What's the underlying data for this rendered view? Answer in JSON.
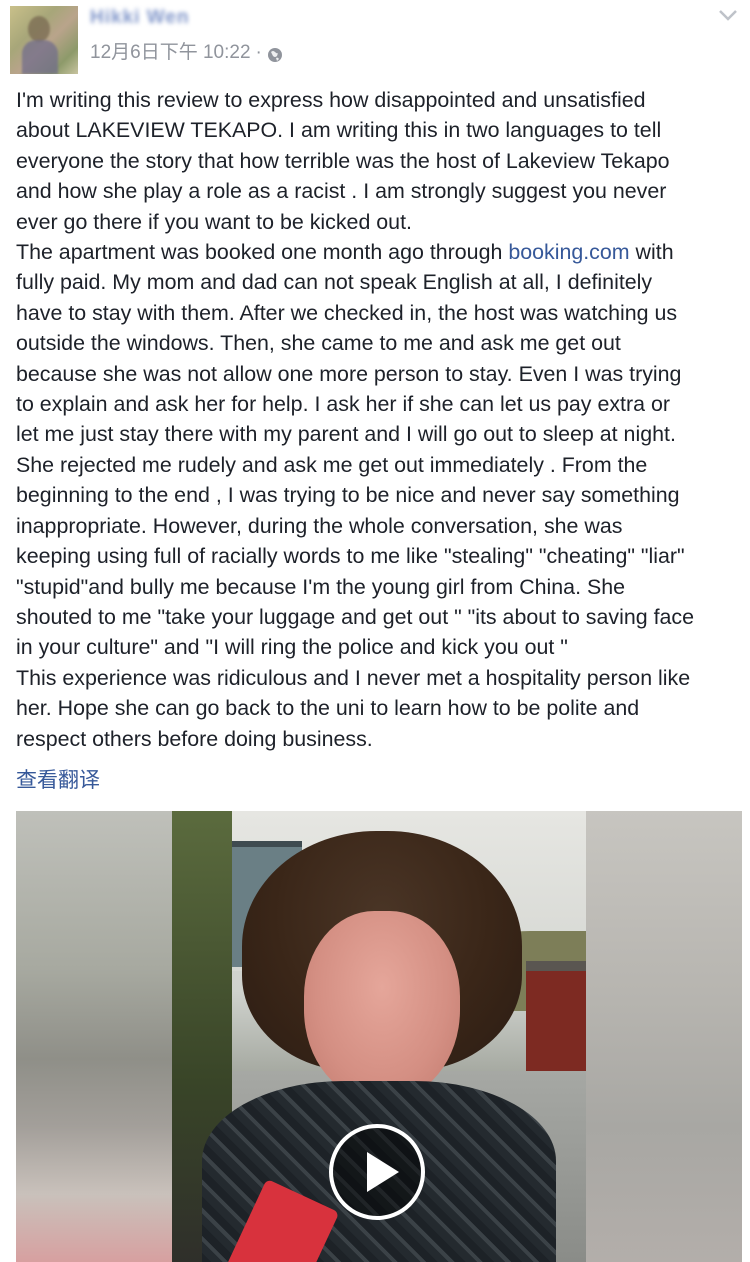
{
  "author": {
    "name": "Hikki Wen",
    "timestamp": "12月6日下午 10:22",
    "separator": "·",
    "privacy_icon": "globe-icon"
  },
  "post": {
    "lines": [
      "I'm writing this review to express how disappointed and unsatisfied",
      "about LAKEVIEW TEKAPO. I am writing this in two languages to tell",
      "everyone the story that how terrible was the host of Lakeview Tekapo",
      "and how she play a role as a racist . I am strongly suggest you never",
      "ever go there if you want to be kicked out.",
      null,
      "fully paid. My mom and dad can not speak English at all, I definitely",
      "have to stay with them. After we checked in, the host was watching us",
      "outside the windows. Then, she came to me and ask me get out",
      "because she was not allow one more person to stay. Even I was trying",
      "to explain and ask her for help. I ask her if she can let us pay extra or",
      "let me just stay there with my parent and I will go out to sleep at night.",
      "She rejected me rudely and ask me get out immediately . From the",
      "beginning to the end , I was trying to be nice and never say something",
      "inappropriate. However, during the whole conversation, she was",
      "keeping using full of racially words to me like \"stealing\" \"cheating\" \"liar\"",
      "\"stupid\"and bully me because I'm the young girl from China. She",
      "shouted to me \"take your luggage and get out \" \"its about to saving face",
      "in your culture\" and \"I will ring the police and kick you out \"",
      "This experience was ridiculous and I never met a hospitality person like",
      "her. Hope she can go back to the uni to learn how to be polite and",
      "respect others before doing business."
    ],
    "booked_line": {
      "before": "The apartment was booked one month ago through ",
      "link": "booking.com",
      "after": " with"
    },
    "translate_label": "查看翻译"
  },
  "video": {
    "play_icon": "play-icon"
  },
  "colors": {
    "link": "#365899",
    "text": "#1d2129",
    "meta": "#90949c"
  }
}
